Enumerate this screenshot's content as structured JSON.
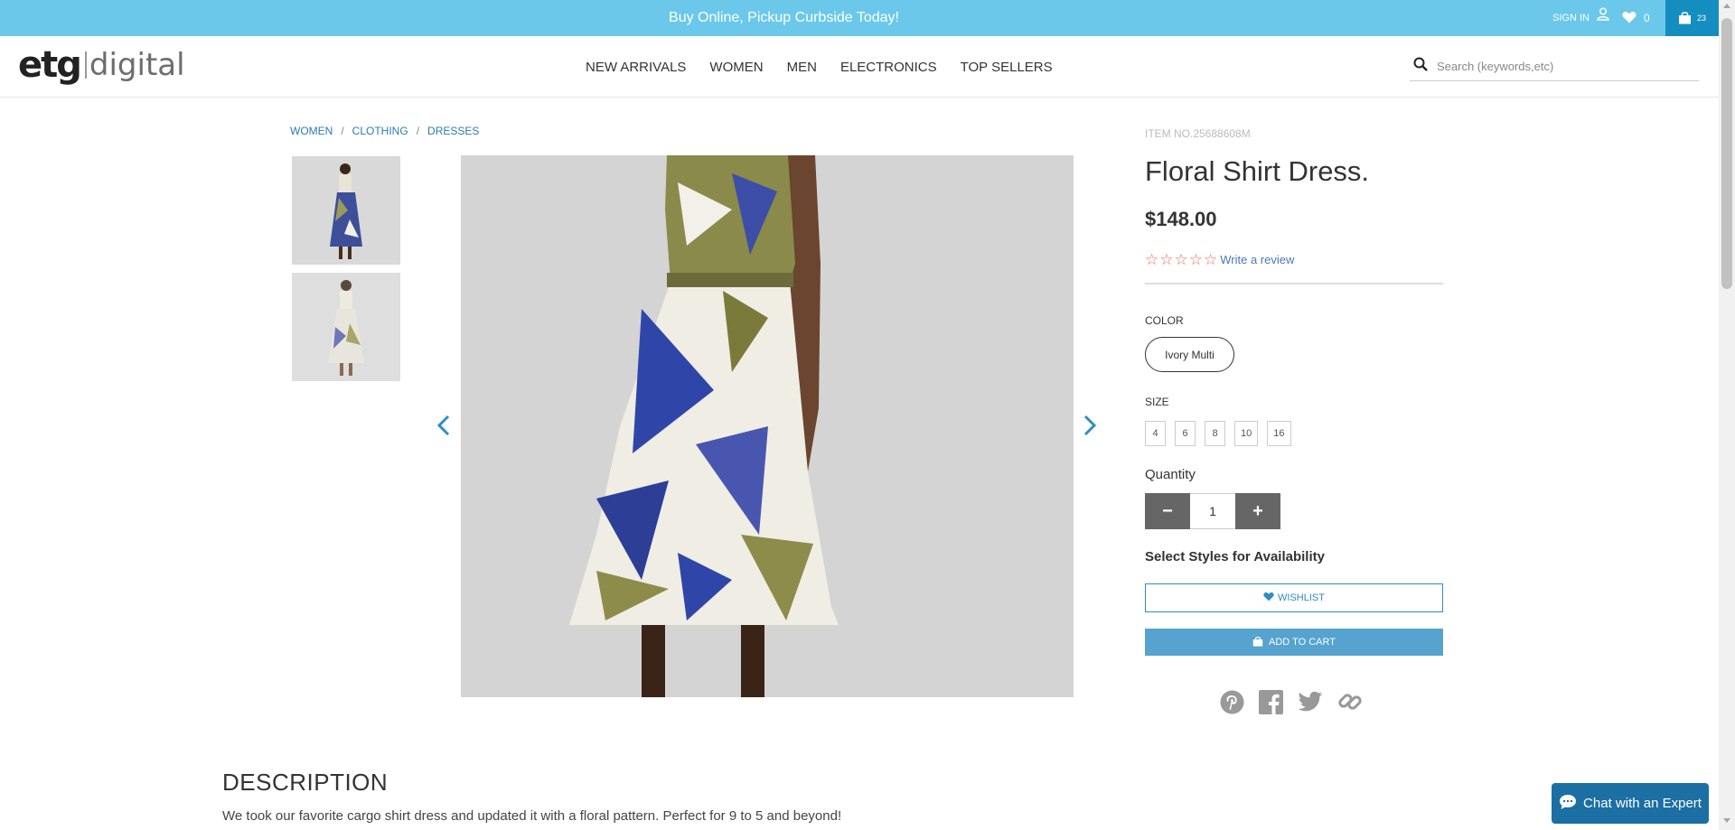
{
  "promo": {
    "text": "Buy Online, Pickup Curbside Today!"
  },
  "account": {
    "signin_label": "SIGN IN",
    "wishlist_count": "0",
    "cart_count": "23"
  },
  "logo": {
    "etg": "etg",
    "digital": "digital"
  },
  "nav": {
    "items": [
      "NEW ARRIVALS",
      "WOMEN",
      "MEN",
      "ELECTRONICS",
      "TOP SELLERS"
    ]
  },
  "search": {
    "placeholder": "Search (keywords,etc)"
  },
  "breadcrumb": {
    "items": [
      "WOMEN",
      "CLOTHING",
      "DRESSES"
    ],
    "separator": "/"
  },
  "product": {
    "item_no": "ITEM NO.25688608M",
    "title": "Floral Shirt Dress.",
    "price": "$148.00",
    "rating_stars": 0,
    "review_link": "Write a review",
    "color_label": "COLOR",
    "color_value": "Ivory Multi",
    "size_label": "SIZE",
    "sizes": [
      "4",
      "6",
      "8",
      "10",
      "16"
    ],
    "quantity_label": "Quantity",
    "quantity": "1",
    "availability": "Select Styles for Availability",
    "wishlist_button": "WISHLIST",
    "add_to_cart": "ADD TO CART"
  },
  "description": {
    "heading": "DESCRIPTION",
    "text": "We took our favorite cargo shirt dress and updated it with a floral pattern. Perfect for 9 to 5 and beyond!"
  },
  "chat": {
    "label": "Chat with an Expert"
  },
  "colors": {
    "promo_bg": "#6bc8ea",
    "cart_bg": "#148ec0",
    "link": "#2a7bb0",
    "button": "#56a3cf",
    "chat_bg": "#1b6fa3",
    "star": "#e8705a"
  }
}
